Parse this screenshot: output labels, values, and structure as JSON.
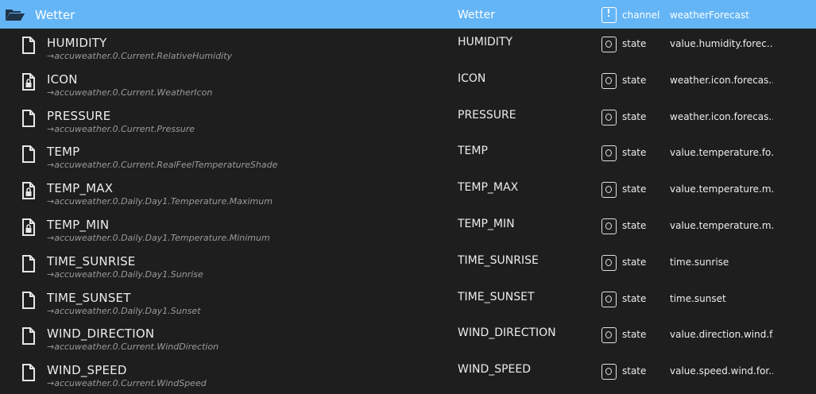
{
  "channel": {
    "name": "Wetter",
    "col2": "Wetter",
    "type": "channel",
    "role": "weatherForecast"
  },
  "rows": [
    {
      "name": "HUMIDITY",
      "path": "→accuweather.0.Current.RelativeHumidity",
      "col2": "HUMIDITY",
      "type": "state",
      "role": "value.humidity.forec...",
      "locked": false
    },
    {
      "name": "ICON",
      "path": "→accuweather.0.Current.WeatherIcon",
      "col2": "ICON",
      "type": "state",
      "role": "weather.icon.forecas...",
      "locked": true
    },
    {
      "name": "PRESSURE",
      "path": "→accuweather.0.Current.Pressure",
      "col2": "PRESSURE",
      "type": "state",
      "role": "weather.icon.forecas...",
      "locked": false
    },
    {
      "name": "TEMP",
      "path": "→accuweather.0.Current.RealFeelTemperatureShade",
      "col2": "TEMP",
      "type": "state",
      "role": "value.temperature.fo...",
      "locked": false
    },
    {
      "name": "TEMP_MAX",
      "path": "→accuweather.0.Daily.Day1.Temperature.Maximum",
      "col2": "TEMP_MAX",
      "type": "state",
      "role": "value.temperature.m...",
      "locked": true
    },
    {
      "name": "TEMP_MIN",
      "path": "→accuweather.0.Daily.Day1.Temperature.Minimum",
      "col2": "TEMP_MIN",
      "type": "state",
      "role": "value.temperature.m...",
      "locked": true
    },
    {
      "name": "TIME_SUNRISE",
      "path": "→accuweather.0.Daily.Day1.Sunrise",
      "col2": "TIME_SUNRISE",
      "type": "state",
      "role": "time.sunrise",
      "locked": false
    },
    {
      "name": "TIME_SUNSET",
      "path": "→accuweather.0.Daily.Day1.Sunset",
      "col2": "TIME_SUNSET",
      "type": "state",
      "role": "time.sunset",
      "locked": false
    },
    {
      "name": "WIND_DIRECTION",
      "path": "→accuweather.0.Current.WindDirection",
      "col2": "WIND_DIRECTION",
      "type": "state",
      "role": "value.direction.wind.f...",
      "locked": false
    },
    {
      "name": "WIND_SPEED",
      "path": "→accuweather.0.Current.WindSpeed",
      "col2": "WIND_SPEED",
      "type": "state",
      "role": "value.speed.wind.for...",
      "locked": false
    }
  ],
  "colors": {
    "header_bg": "#64b5f6",
    "page_bg": "#1e1e1e",
    "text": "#ececec",
    "path_text": "#9a9a9a"
  },
  "icons": {
    "channel": "folder-open-icon",
    "state": "file-icon",
    "locked_state": "file-lock-icon",
    "type_channel": "info-box-icon",
    "type_state": "state-box-icon"
  }
}
